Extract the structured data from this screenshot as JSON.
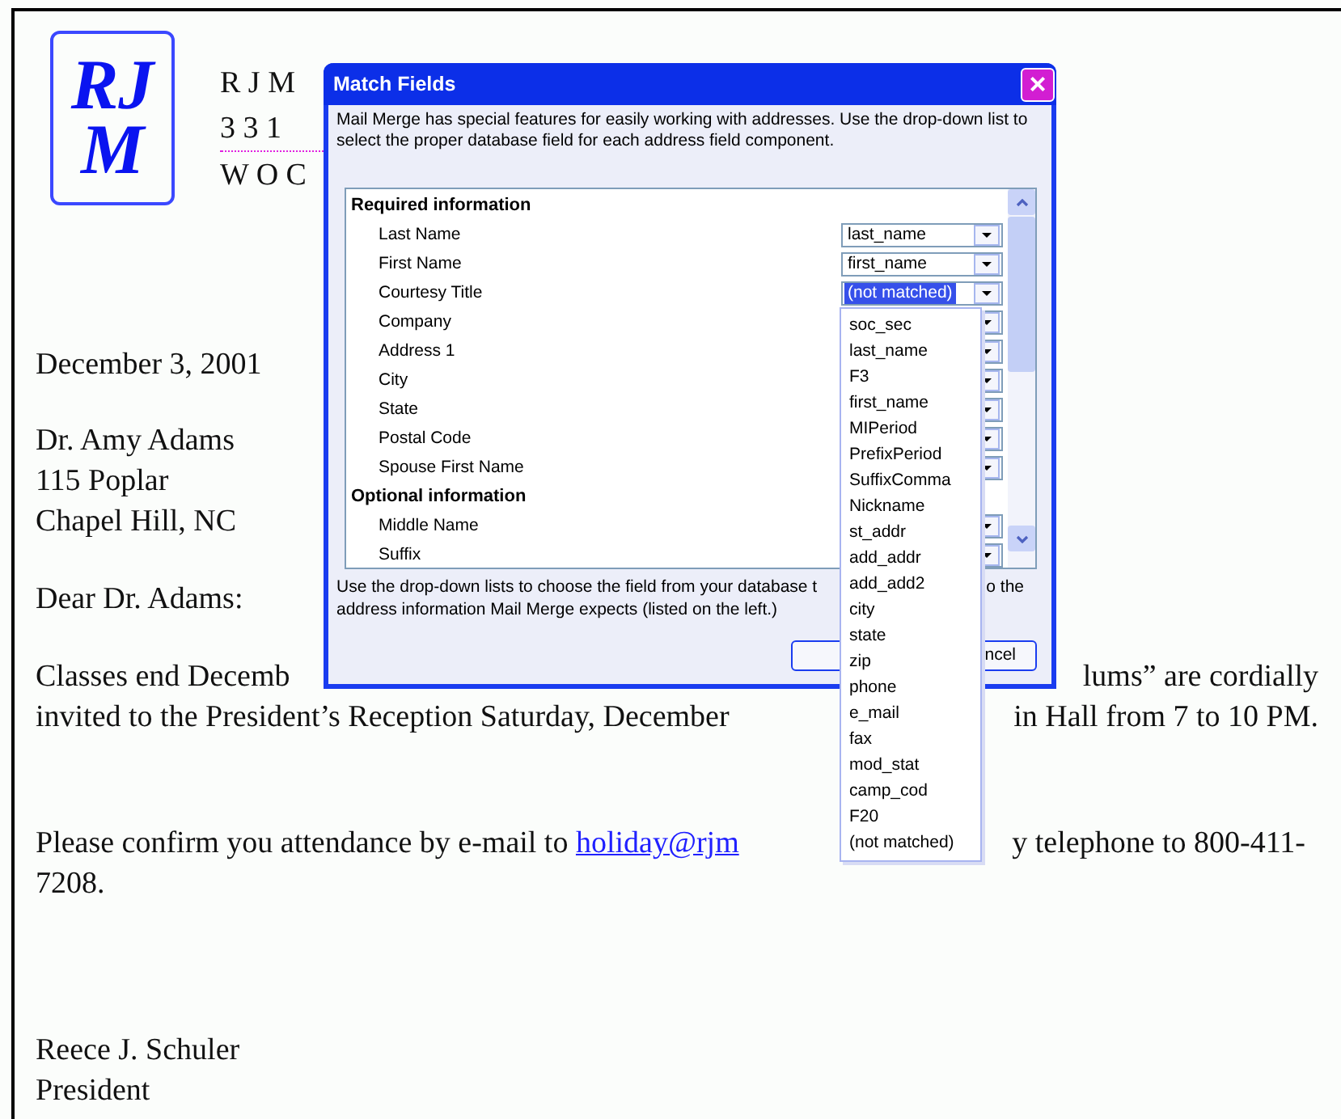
{
  "letter": {
    "logo_text": [
      "RJ",
      "M"
    ],
    "letterhead": [
      "R J M",
      "3 3 1",
      "W O C"
    ],
    "date": "December 3, 2001",
    "address": [
      "Dr. Amy Adams",
      "115 Poplar",
      "Chapel Hill, NC"
    ],
    "salutation": "Dear Dr. Adams:",
    "paragraph_1": [
      {
        "left": "Classes end Decemb",
        "right": "lums” are cordially"
      },
      {
        "left": "invited to the President’s Reception Saturday, December",
        "right": "in Hall from 7 to 10 PM."
      }
    ],
    "paragraph_2": {
      "text": "Please confirm you attendance by e-mail to ",
      "link": "holiday@rjm",
      "right": "y telephone to 800-411-",
      "line_2": "7208."
    },
    "signature": [
      "Reece J. Schuler",
      "President"
    ]
  },
  "dialog": {
    "title": "Match Fields",
    "close": "×",
    "description": "Mail Merge has special features for easily working with addresses.  Use the drop-down list to select the proper database field for each address field component.",
    "sections": [
      {
        "heading": "Required information",
        "fields": [
          {
            "label": "Last Name",
            "value": "last_name",
            "highlighted": false
          },
          {
            "label": "First Name",
            "value": "first_name",
            "highlighted": false
          },
          {
            "label": "Courtesy Title",
            "value": "(not matched)",
            "highlighted": true
          },
          {
            "label": "Company"
          },
          {
            "label": "Address 1"
          },
          {
            "label": "City"
          },
          {
            "label": "State"
          },
          {
            "label": "Postal Code"
          },
          {
            "label": "Spouse First Name"
          }
        ]
      },
      {
        "heading": "Optional information",
        "fields": [
          {
            "label": "Middle Name"
          },
          {
            "label": "Suffix"
          }
        ]
      }
    ],
    "footer_left": "Use the drop-down lists to choose the field from your database t",
    "footer_right": "o the",
    "footer_line_2": "address information Mail Merge expects (listed on the left.)",
    "cancel_button": "ncel",
    "dropdown_options": [
      "soc_sec",
      "last_name",
      "F3",
      "first_name",
      "MIPeriod",
      "PrefixPeriod",
      "SuffixComma",
      "Nickname",
      "st_addr",
      "add_addr",
      "add_add2",
      "city",
      "state",
      "zip",
      "phone",
      "e_mail",
      "fax",
      "mod_stat",
      "camp_cod",
      "F20",
      "(not matched)"
    ]
  }
}
